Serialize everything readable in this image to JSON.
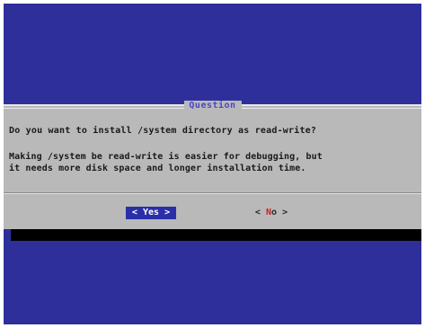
{
  "dialog": {
    "title": "Question",
    "question": "Do you want to install /system directory as read-write?",
    "description_lines": [
      "Making /system be read-write is easier for debugging, but",
      "it needs more disk space and longer installation time."
    ]
  },
  "buttons": {
    "yes": {
      "left_bracket": "<",
      "hotkey": "Y",
      "rest": "es",
      "right_bracket": ">",
      "state": "selected"
    },
    "no": {
      "left_bracket": "<",
      "hotkey": "N",
      "rest": "o",
      "right_bracket": ">"
    }
  },
  "colors": {
    "background": "#2e2f9b",
    "dialog": "#b9b9b9",
    "title": "#4848c8",
    "selected_button": "#2a2fa8",
    "hotkey": "#cc1f1f",
    "shadow": "#000000"
  }
}
